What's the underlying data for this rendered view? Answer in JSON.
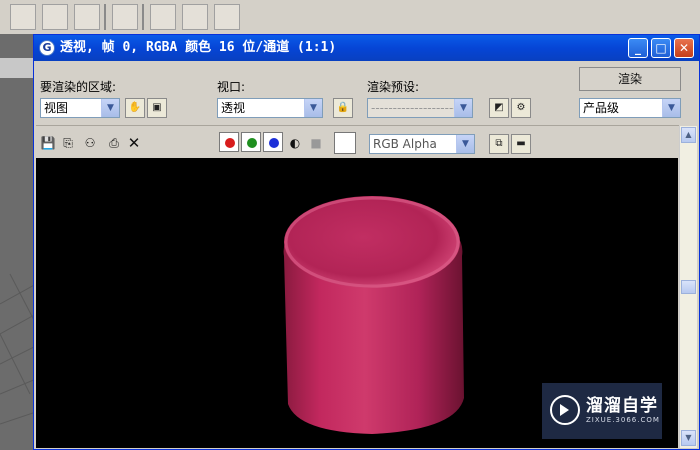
{
  "window": {
    "title": "透视, 帧 0, RGBA 颜色 16 位/通道 (1:1)",
    "icon": "app-g-icon",
    "controls": {
      "minimize": "_",
      "maximize": "□",
      "close": "✕"
    }
  },
  "controls": {
    "area_label": "要渲染的区域:",
    "area_value": "视图",
    "viewport_label": "视口:",
    "viewport_value": "透视",
    "preset_label": "渲染预设:",
    "preset_value": "----------------------",
    "render_button": "渲染",
    "quality_value": "产品级"
  },
  "image_toolbar": {
    "icons": [
      "save-icon",
      "copy-icon",
      "clone-icon",
      "print-icon",
      "clear-icon"
    ],
    "channels": [
      {
        "name": "red-channel",
        "color": "#d81c1c"
      },
      {
        "name": "green-channel",
        "color": "#1f8f1f"
      },
      {
        "name": "blue-channel",
        "color": "#1c2fd8"
      }
    ],
    "channel_display_value": "RGB Alpha"
  },
  "render": {
    "object": "pink-cylinder",
    "object_color": "#c0255a",
    "background_color": "#000000"
  },
  "watermark": {
    "text": "溜溜自学",
    "url": "ZIXUE.3066.COM"
  }
}
